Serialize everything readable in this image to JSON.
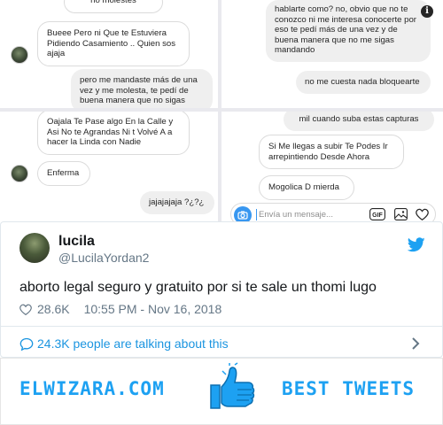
{
  "panel1": {
    "top_fragment": "no molestes",
    "msg_in_1": "Bueee Pero ni Que te Estuviera Pidiendo Casamiento .. Quien sos ajaja",
    "msg_out_1": "pero me mandaste más de una vez y me molesta, te pedí de buena manera que no sigas"
  },
  "panel2": {
    "msg_out_1": "hablarte como? no, obvio que no te conozco ni me interesa conocerte por eso te pedí más de una vez y de buena manera que no me sigas mandando",
    "msg_out_2": "no me cuesta nada bloquearte"
  },
  "panel3": {
    "msg_in_1": "Oajala Te Pase algo En la Calle y Asi No te Agrandas Ni t Volvé A a hacer la Linda con Nadie",
    "msg_in_2": "Enferma",
    "msg_out_1": "jajajajaja ?¿?¿"
  },
  "panel4": {
    "msg_out_1": "mil cuando suba estas capturas",
    "msg_in_1": "Si Me llegas a subir Te Podes Ir arrepintiendo Desde Ahora",
    "msg_in_2": "Mogolica D mierda",
    "composer_placeholder": "Envía un mensaje...",
    "gif_label": "GIF"
  },
  "tweet": {
    "name": "lucila",
    "handle": "@LucilaYordan2",
    "text": "aborto legal seguro y gratuito por si te sale un thomi lugo",
    "likes": "28.6K",
    "timestamp": "10:55 PM - Nov 16, 2018",
    "talking": "24.3K people are talking about this"
  },
  "footer": {
    "brand_left": "ELWIZARA.COM",
    "brand_right": "BEST TWEETS"
  },
  "colors": {
    "twitter_blue": "#1da1f2",
    "link_blue": "#1b95e0",
    "instagram_blue": "#3897f0"
  }
}
